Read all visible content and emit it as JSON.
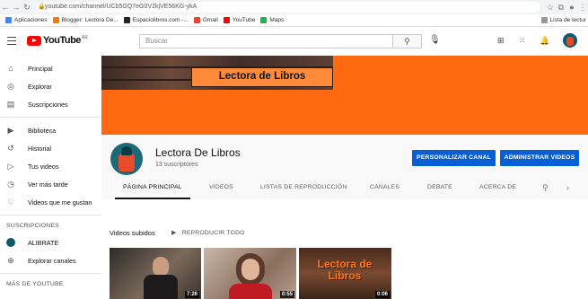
{
  "browser": {
    "url": "youtube.com/channel/UCb5GQ7eG0V2kjVE56KG-ykA",
    "bookmarks": [
      {
        "label": "Aplicaciones",
        "color": "#4285f4"
      },
      {
        "label": "Blogger: Lectora De...",
        "color": "#f57c00"
      },
      {
        "label": "Espaciolibros.com -...",
        "color": "#222222"
      },
      {
        "label": "Gmail",
        "color": "#ea4335"
      },
      {
        "label": "YouTube",
        "color": "#ff0000"
      },
      {
        "label": "Maps",
        "color": "#34a853"
      }
    ],
    "reading_list": "Lista de lectur"
  },
  "header": {
    "logo_text": "YouTube",
    "logo_region": "AR",
    "search_placeholder": "Buscar"
  },
  "sidebar": {
    "main_items": [
      {
        "label": "Principal",
        "icon": "home-icon",
        "glyph": "⌂"
      },
      {
        "label": "Explorar",
        "icon": "compass-icon",
        "glyph": "◎"
      },
      {
        "label": "Suscripciones",
        "icon": "subscriptions-icon",
        "glyph": "▤"
      }
    ],
    "library_items": [
      {
        "label": "Biblioteca",
        "icon": "library-icon",
        "glyph": "▶"
      },
      {
        "label": "Historial",
        "icon": "history-icon",
        "glyph": "↺"
      },
      {
        "label": "Tus videos",
        "icon": "your-videos-icon",
        "glyph": "▷"
      },
      {
        "label": "Ver más tarde",
        "icon": "watch-later-icon",
        "glyph": "◷"
      },
      {
        "label": "Videos que me gustan",
        "icon": "like-icon",
        "glyph": "👍"
      }
    ],
    "subs_heading": "SUSCRIPCIONES",
    "subs_items": [
      {
        "label": "ALIBRATE"
      },
      {
        "label": "Explorar canales",
        "glyph": "⊕"
      }
    ],
    "more_heading": "MÁS DE YOUTUBE"
  },
  "banner": {
    "title": "Lectora de Libros",
    "color": "#ff6a10"
  },
  "channel": {
    "name": "Lectora De Libros",
    "subscribers": "13 suscriptores",
    "customize_button": "PERSONALIZAR CANAL",
    "manage_button": "ADMINISTRAR VIDEOS",
    "tabs": [
      "PÁGINA PRINCIPAL",
      "VIDEOS",
      "LISTAS DE REPRODUCCIÓN",
      "CANALES",
      "DEBATE",
      "ACERCA DE"
    ]
  },
  "uploads": {
    "heading": "Videos subidos",
    "play_all": "REPRODUCIR TODO",
    "videos": [
      {
        "duration": "7:26"
      },
      {
        "duration": "0:55"
      },
      {
        "duration": "0:06",
        "thumb_text": "Lectora de Libros"
      }
    ]
  }
}
